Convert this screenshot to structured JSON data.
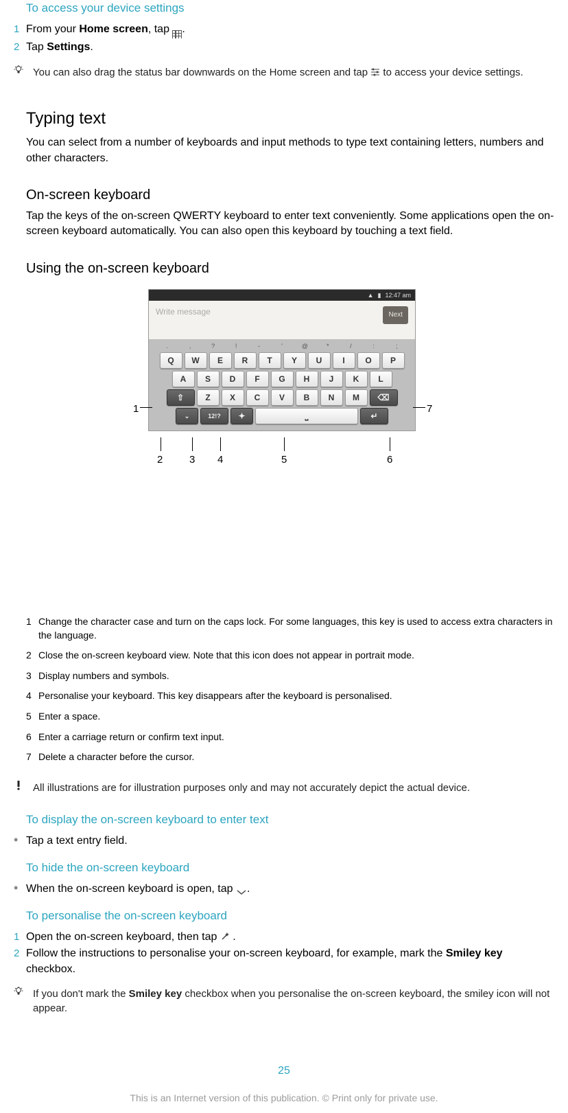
{
  "sec1": {
    "heading": "To access your device settings",
    "step1_pre": "From your ",
    "step1_bold": "Home screen",
    "step1_post": ", tap ",
    "step1_end": ".",
    "step2_pre": "Tap ",
    "step2_bold": "Settings",
    "step2_end": ".",
    "tip_pre": "You can also drag the status bar downwards on the Home screen and tap ",
    "tip_post": " to access your device settings."
  },
  "typing": {
    "heading": "Typing text",
    "body": "You can select from a number of keyboards and input methods to type text containing letters, numbers and other characters."
  },
  "osk": {
    "heading": "On-screen keyboard",
    "body": "Tap the keys of the on-screen QWERTY keyboard to enter text conveniently. Some applications open the on-screen keyboard automatically. You can also open this keyboard by touching a text field."
  },
  "using": {
    "heading": "Using the on-screen keyboard"
  },
  "kbd": {
    "time": "12:47 am",
    "placeholder": "Write message",
    "next": "Next",
    "sym": [
      ".",
      ",",
      "?",
      "!",
      "-",
      "'",
      "@",
      "*",
      "/",
      ":",
      ";"
    ],
    "row1": [
      "Q",
      "W",
      "E",
      "R",
      "T",
      "Y",
      "U",
      "I",
      "O",
      "P"
    ],
    "row2": [
      "A",
      "S",
      "D",
      "F",
      "G",
      "H",
      "J",
      "K",
      "L"
    ],
    "row3": [
      "Z",
      "X",
      "C",
      "V",
      "B",
      "N",
      "M"
    ],
    "shift": "⇧",
    "bksp": "⌫",
    "hide": "⌄",
    "numsym": "12!?",
    "wand": "✦",
    "space": "⎵",
    "enter": "↵"
  },
  "callouts": {
    "c1": "1",
    "c2": "2",
    "c3": "3",
    "c4": "4",
    "c5": "5",
    "c6": "6",
    "c7": "7"
  },
  "legend": {
    "l1": "Change the character case and turn on the caps lock. For some languages, this key is used to access extra characters in the language.",
    "l2": "Close the on-screen keyboard view. Note that this icon does not appear in portrait mode.",
    "l3": "Display numbers and symbols.",
    "l4": "Personalise your keyboard. This key disappears after the keyboard is personalised.",
    "l5": "Enter a space.",
    "l6": "Enter a carriage return or confirm text input.",
    "l7": "Delete a character before the cursor."
  },
  "warn": "All illustrations are for illustration purposes only and may not accurately depict the actual device.",
  "display": {
    "heading": "To display the on-screen keyboard to enter text",
    "bullet": "Tap a text entry field."
  },
  "hide": {
    "heading": "To hide the on-screen keyboard",
    "bullet_pre": "When the on-screen keyboard is open, tap ",
    "bullet_end": "."
  },
  "personalise": {
    "heading": "To personalise the on-screen keyboard",
    "s1_pre": "Open the on-screen keyboard, then tap ",
    "s1_end": " .",
    "s2_pre": "Follow the instructions to personalise your on-screen keyboard, for example, mark the ",
    "s2_bold": "Smiley key",
    "s2_end": " checkbox.",
    "tip_pre": "If you don't mark the ",
    "tip_bold": "Smiley key",
    "tip_post": " checkbox when you personalise the on-screen keyboard, the smiley icon will not appear."
  },
  "pagenum": "25",
  "footer": "This is an Internet version of this publication. © Print only for private use.",
  "nums": {
    "n1": "1",
    "n2": "2",
    "n3": "3",
    "n4": "4",
    "n5": "5",
    "n6": "6",
    "n7": "7"
  }
}
